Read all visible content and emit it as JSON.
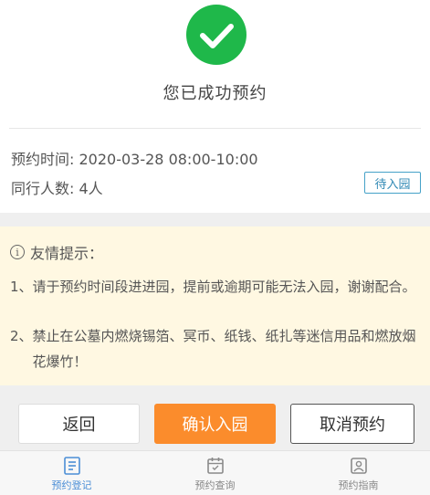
{
  "success": {
    "icon": "check-icon",
    "title": "您已成功预约",
    "color": "#1fb84a"
  },
  "reservation": {
    "time_label": "预约时间:",
    "time_value": "2020-03-28 08:00-10:00",
    "count_label": "同行人数:",
    "count_value": "4人",
    "status": "待入园"
  },
  "tips": {
    "icon": "info-icon",
    "header": "友情提示：",
    "items": [
      {
        "num": "1、",
        "text": "请于预约时间段进进园，提前或逾期可能无法入园，谢谢配合。"
      },
      {
        "num": "2、",
        "text": "禁止在公墓内燃烧锡箔、冥币、纸钱、纸扎等迷信用品和燃放烟花爆竹！"
      }
    ]
  },
  "buttons": {
    "back": "返回",
    "confirm": "确认入园",
    "cancel": "取消预约",
    "confirm_color": "#fb8c2c"
  },
  "tabbar": {
    "items": [
      {
        "label": "预约登记",
        "icon": "register-icon",
        "active": true
      },
      {
        "label": "预约查询",
        "icon": "calendar-icon",
        "active": false
      },
      {
        "label": "预约指南",
        "icon": "guide-icon",
        "active": false
      }
    ],
    "active_color": "#4b8ed6"
  }
}
